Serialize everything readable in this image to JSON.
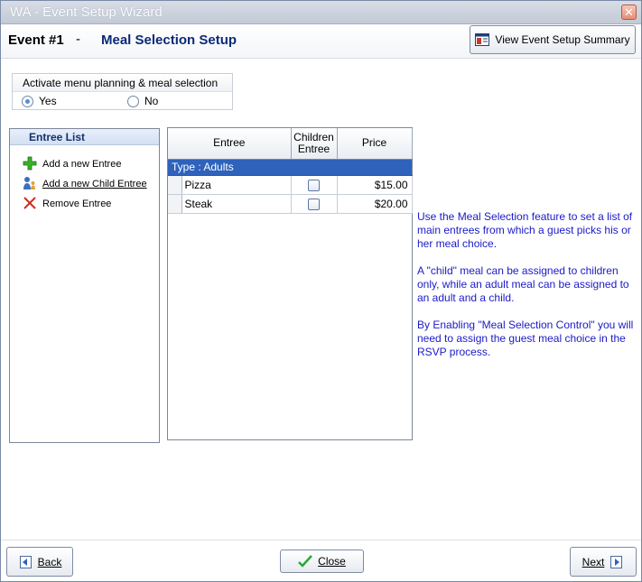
{
  "window": {
    "title": "WA - Event Setup Wizard",
    "close_glyph": "✕"
  },
  "header": {
    "event_number": "Event #1",
    "separator": "-",
    "title": "Meal Selection Setup",
    "summary_button_label": "View Event Setup Summary"
  },
  "activate": {
    "title": "Activate menu planning & meal selection",
    "options": [
      {
        "label": "Yes",
        "selected": true
      },
      {
        "label": "No",
        "selected": false
      }
    ]
  },
  "entree_list": {
    "title": "Entree List",
    "actions": [
      {
        "label": "Add a new Entree",
        "icon": "plus-icon"
      },
      {
        "label": "Add a new Child Entree",
        "icon": "child-user-icon"
      },
      {
        "label": "Remove Entree",
        "icon": "remove-x-icon"
      }
    ]
  },
  "grid": {
    "columns": [
      "Entree",
      "Children Entree",
      "Price"
    ],
    "group": "Type : Adults",
    "rows": [
      {
        "entree": "Pizza",
        "children": false,
        "price": "$15.00"
      },
      {
        "entree": "Steak",
        "children": false,
        "price": "$20.00"
      }
    ]
  },
  "info": {
    "paragraphs": [
      "Use the Meal Selection feature to set a list of main entrees from which a guest picks his or her meal choice.",
      "A \"child\" meal can be assigned to children only, while an adult meal can be assigned to an adult and a child.",
      "By Enabling \"Meal Selection Control\" you will need to assign the guest meal choice in the RSVP process."
    ]
  },
  "footer": {
    "back_label": "Back",
    "close_label": "Close",
    "next_label": "Next"
  },
  "colors": {
    "accent": "#2e62bb",
    "header_title": "#0b2a78",
    "info_text": "#1a1ac8"
  }
}
